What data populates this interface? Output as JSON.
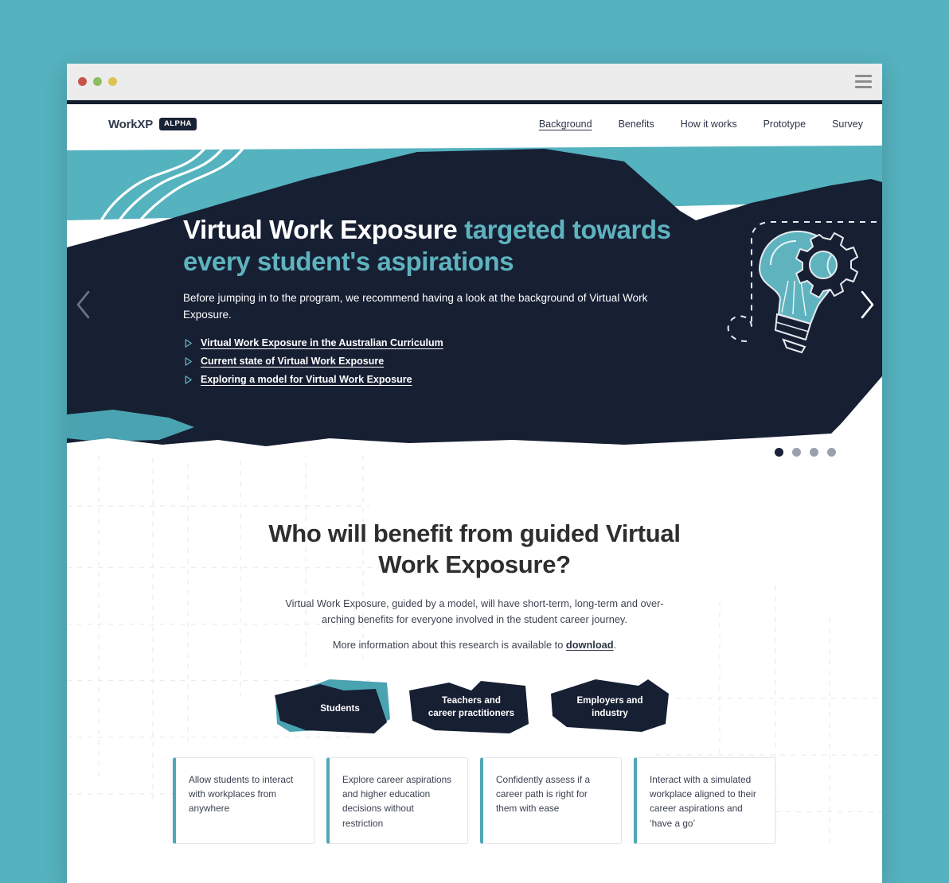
{
  "browser": {
    "traffic_lights": [
      "red",
      "green",
      "yellow"
    ],
    "menu_icon": "hamburger-icon"
  },
  "site": {
    "brand_name": "WorkXP",
    "brand_badge": "ALPHA",
    "nav": [
      {
        "label": "Background",
        "active": true
      },
      {
        "label": "Benefits",
        "active": false
      },
      {
        "label": "How it works",
        "active": false
      },
      {
        "label": "Prototype",
        "active": false
      },
      {
        "label": "Survey",
        "active": false
      }
    ]
  },
  "hero": {
    "title_white": "Virtual Work Exposure",
    "title_accent": "targeted towards every student's aspirations",
    "subtitle": "Before jumping in to the program, we recommend having a look at the background of Virtual Work Exposure.",
    "links": [
      "Virtual Work Exposure in the Australian Curriculum",
      "Current state of Virtual Work Exposure",
      "Exploring a model for Virtual Work Exposure"
    ],
    "prev_arrow": "‹",
    "next_arrow": "›",
    "illustration": "lightbulb-gear-icon",
    "carousel_dots": 4,
    "active_dot": 0
  },
  "benefits": {
    "title_line1": "Who will benefit from guided",
    "title_line2": "Virtual Work Exposure?",
    "paragraph": "Virtual Work Exposure, guided by a model, will have short-term, long-term and over-arching benefits for everyone involved in the student career journey.",
    "paragraph2_before": "More information about this research is available to ",
    "paragraph2_link": "download",
    "paragraph2_after": ".",
    "tabs": [
      {
        "line1": "Students",
        "line2": "",
        "active": true
      },
      {
        "line1": "Teachers and",
        "line2": "career practitioners",
        "active": false
      },
      {
        "line1": "Employers and",
        "line2": "industry",
        "active": false
      }
    ],
    "cards": [
      "Allow students to interact with workplaces from anywhere",
      "Explore career aspirations and higher education decisions without restriction",
      "Confidently assess if a career path is right for them with ease",
      "Interact with a simulated workplace aligned to their career aspirations and ‘have a go’"
    ]
  },
  "colors": {
    "page_bg_teal": "#55b2bf",
    "hero_navy": "#171f33",
    "accent_teal": "#5fb3bf",
    "card_border_teal": "#4fa8b5",
    "text_dark": "#2e2e2e"
  }
}
